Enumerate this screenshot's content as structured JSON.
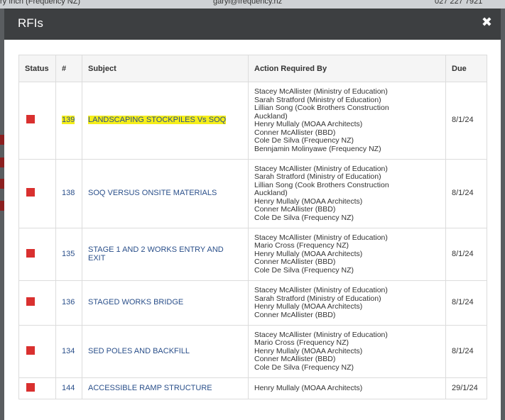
{
  "background": {
    "row_text_left": "ry Inch (Frequency NZ)",
    "row_text_mid": "garyi@frequency.nz",
    "row_text_right": "027 227 7921"
  },
  "modal": {
    "title": "RFIs",
    "close_glyph": "✖"
  },
  "table": {
    "headers": {
      "status": "Status",
      "number": "#",
      "subject": "Subject",
      "action": "Action Required By",
      "due": "Due"
    },
    "rows": [
      {
        "number": "139",
        "subject": "LANDSCAPING STOCKPILES Vs SOQ",
        "highlighted": true,
        "action": [
          "Stacey McAllister (Ministry of Education)",
          "Sarah Stratford (Ministry of Education)",
          "Lillian Song (Cook Brothers Construction",
          "Auckland)",
          "Henry Mullaly (MOAA Architects)",
          "Conner McAllister (BBD)",
          "Cole De Silva (Frequency NZ)",
          "Bennjamin Molinyawe (Frequency NZ)"
        ],
        "due": "8/1/24"
      },
      {
        "number": "138",
        "subject": "SOQ VERSUS ONSITE MATERIALS",
        "highlighted": false,
        "action": [
          "Stacey McAllister (Ministry of Education)",
          "Sarah Stratford (Ministry of Education)",
          "Lillian Song (Cook Brothers Construction",
          "Auckland)",
          "Henry Mullaly (MOAA Architects)",
          "Conner McAllister (BBD)",
          "Cole De Silva (Frequency NZ)"
        ],
        "due": "8/1/24"
      },
      {
        "number": "135",
        "subject": "STAGE 1 AND 2 WORKS ENTRY AND EXIT",
        "highlighted": false,
        "action": [
          "Stacey McAllister (Ministry of Education)",
          "Mario Cross (Frequency NZ)",
          "Henry Mullaly (MOAA Architects)",
          "Conner McAllister (BBD)",
          "Cole De Silva (Frequency NZ)"
        ],
        "due": "8/1/24"
      },
      {
        "number": "136",
        "subject": "STAGED WORKS BRIDGE",
        "highlighted": false,
        "action": [
          "Stacey McAllister (Ministry of Education)",
          "Sarah Stratford (Ministry of Education)",
          "Henry Mullaly (MOAA Architects)",
          "Conner McAllister (BBD)"
        ],
        "due": "8/1/24"
      },
      {
        "number": "134",
        "subject": "SED POLES AND BACKFILL",
        "highlighted": false,
        "action": [
          "Stacey McAllister (Ministry of Education)",
          "Mario Cross (Frequency NZ)",
          "Henry Mullaly (MOAA Architects)",
          "Conner McAllister (BBD)",
          "Cole De Silva (Frequency NZ)"
        ],
        "due": "8/1/24"
      },
      {
        "number": "144",
        "subject": "ACCESSIBLE RAMP STRUCTURE",
        "highlighted": false,
        "action": [
          "Henry Mullaly (MOAA Architects)"
        ],
        "due": "29/1/24"
      }
    ]
  },
  "colors": {
    "header_bg": "#3d3f41",
    "status_overdue": "#d9302f",
    "link": "#2a4f8a",
    "highlight": "#f5ee19"
  }
}
